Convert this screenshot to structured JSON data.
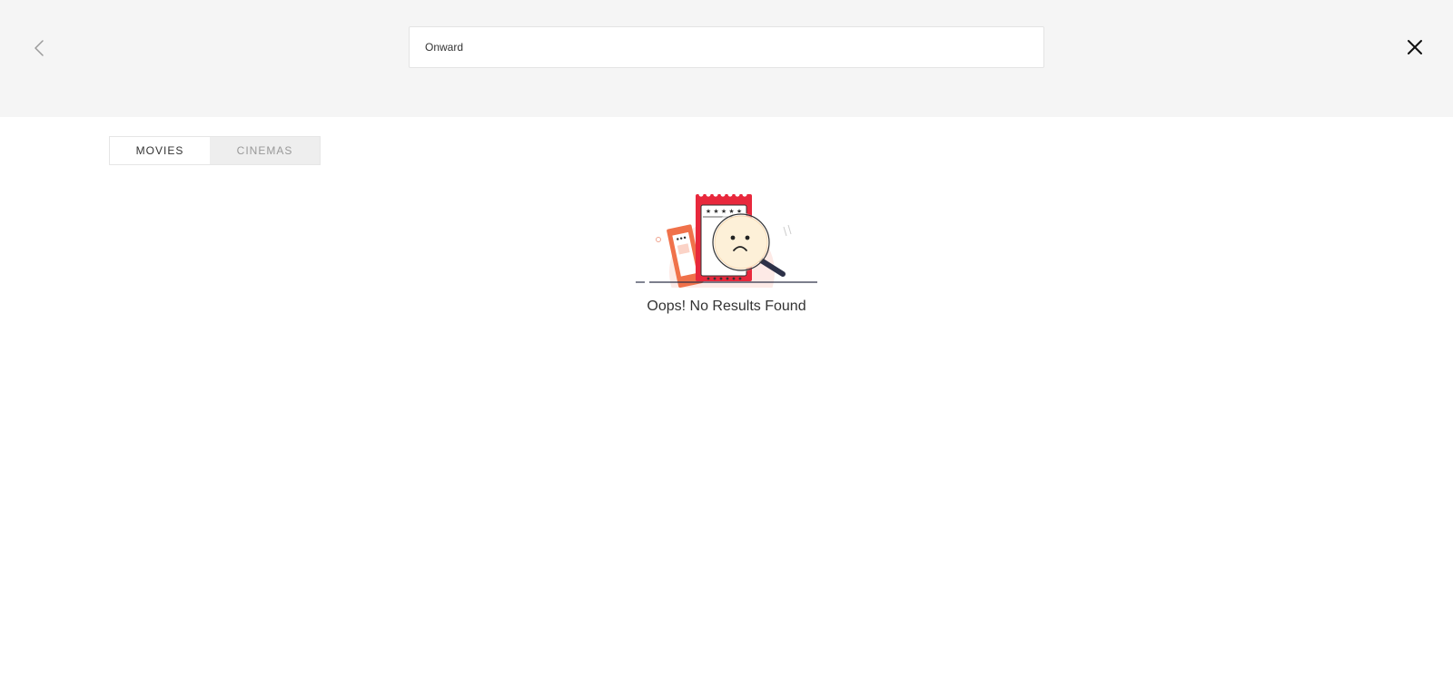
{
  "search": {
    "value": "Onward",
    "placeholder": ""
  },
  "header": {
    "back_icon": "chevron-left-icon",
    "close_icon": "close-icon"
  },
  "tabs": [
    {
      "label": "MOVIES",
      "active": true
    },
    {
      "label": "CINEMAS",
      "active": false
    }
  ],
  "empty_state": {
    "message": "Oops! No Results Found",
    "illustration_icon": "sad-ticket-magnifier-icon"
  },
  "colors": {
    "header_bg": "#f5f5f5",
    "accent_red": "#e8283c",
    "accent_orange": "#f0714a",
    "text_dark": "#333333",
    "tab_inactive_text": "#999999"
  }
}
